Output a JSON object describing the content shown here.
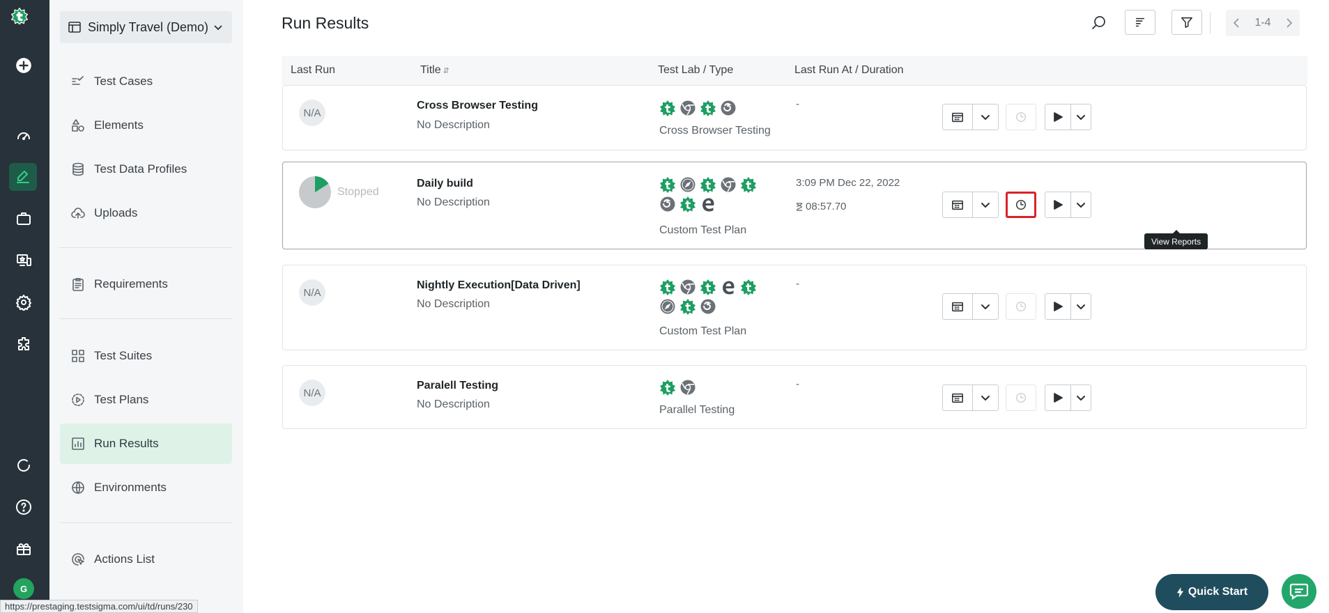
{
  "workspace": {
    "name": "Simply Travel (Demo)"
  },
  "sidebar": {
    "items": [
      {
        "label": "Test Cases",
        "icon": "test-cases-icon"
      },
      {
        "label": "Elements",
        "icon": "elements-icon"
      },
      {
        "label": "Test Data Profiles",
        "icon": "database-icon"
      },
      {
        "label": "Uploads",
        "icon": "cloud-upload-icon"
      },
      {
        "label": "Requirements",
        "icon": "clipboard-icon"
      },
      {
        "label": "Test Suites",
        "icon": "grid-icon"
      },
      {
        "label": "Test Plans",
        "icon": "play-circle-icon"
      },
      {
        "label": "Run Results",
        "icon": "bar-chart-icon",
        "active": true
      },
      {
        "label": "Environments",
        "icon": "globe-icon"
      },
      {
        "label": "Actions List",
        "icon": "cursor-click-icon"
      }
    ]
  },
  "user": {
    "initial": "G"
  },
  "page": {
    "title": "Run Results"
  },
  "pager": {
    "range": "1-4"
  },
  "table": {
    "headers": {
      "last_run": "Last Run",
      "title": "Title",
      "lab": "Test Lab / Type",
      "run_at": "Last Run At / Duration"
    },
    "rows": [
      {
        "status": "N/A",
        "title": "Cross Browser Testing",
        "description": "No Description",
        "labs": [
          "testsigma",
          "chrome",
          "testsigma",
          "firefox"
        ],
        "type": "Cross Browser Testing",
        "run_at": "-"
      },
      {
        "status": "Stopped",
        "title": "Daily build",
        "description": "No Description",
        "labs": [
          "testsigma",
          "safari",
          "testsigma",
          "chrome",
          "testsigma",
          "firefox",
          "testsigma",
          "edge"
        ],
        "type": "Custom Test Plan",
        "run_at": "3:09 PM Dec 22, 2022",
        "duration": "08:57.70",
        "progress_fraction": 0.16
      },
      {
        "status": "N/A",
        "title": "Nightly Execution[Data Driven]",
        "description": "No Description",
        "labs": [
          "testsigma",
          "chrome",
          "testsigma",
          "edge",
          "testsigma",
          "safari",
          "testsigma",
          "firefox"
        ],
        "type": "Custom Test Plan",
        "run_at": "-"
      },
      {
        "status": "N/A",
        "title": "Paralell Testing",
        "description": "No Description",
        "labs": [
          "testsigma",
          "chrome"
        ],
        "type": "Parallel Testing",
        "run_at": "-"
      }
    ]
  },
  "tooltip": "View Reports",
  "quick_start": "Quick Start",
  "status_url": "https://prestaging.testsigma.com/ui/td/runs/230",
  "colors": {
    "brand_green": "#1e9e63",
    "rail": "#27323a",
    "highlight_red": "#d8232a",
    "quick_start_bg": "#1f4d5e"
  }
}
